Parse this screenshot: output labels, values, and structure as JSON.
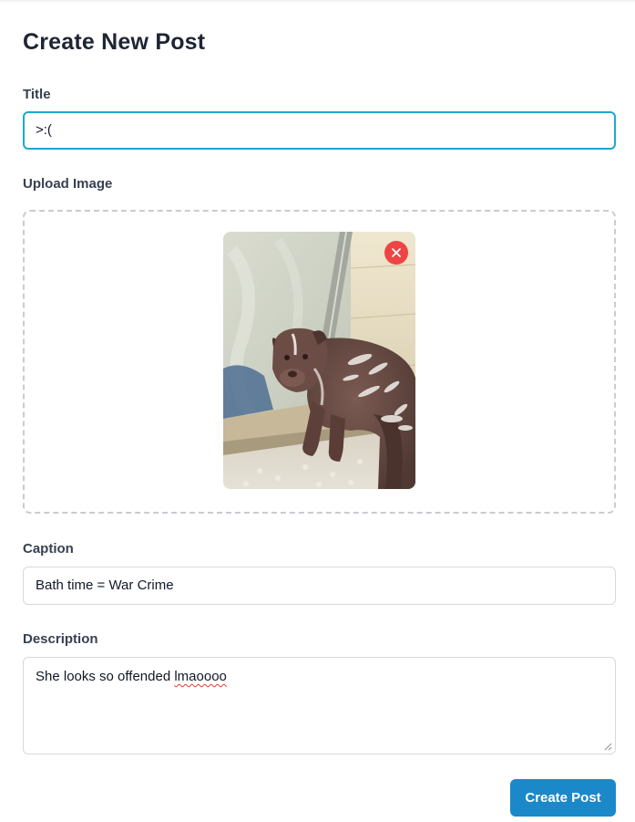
{
  "form": {
    "heading": "Create New Post",
    "title": {
      "label": "Title",
      "value": ">:("
    },
    "upload": {
      "label": "Upload Image",
      "preview_icon": "dog-photo",
      "remove_icon": "close-icon",
      "remove_color": "#ef4444"
    },
    "caption": {
      "label": "Caption",
      "value": "Bath time = War Crime"
    },
    "description": {
      "label": "Description",
      "value_prefix": "She looks so offended ",
      "value_misspelled": "lmaoooo"
    },
    "submit_label": "Create Post"
  },
  "colors": {
    "accent": "#1a88c9",
    "focus_ring": "#1ea7d1",
    "remove": "#ef4444"
  }
}
